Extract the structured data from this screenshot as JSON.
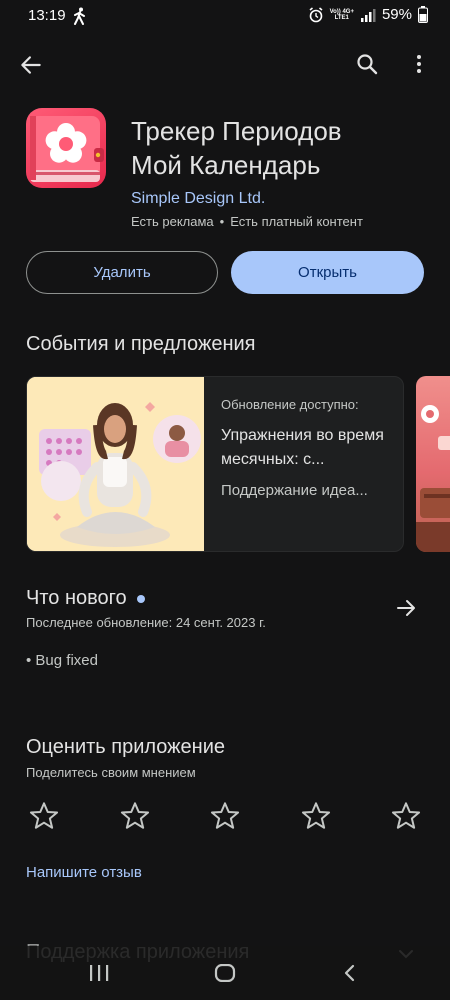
{
  "status": {
    "time": "13:19",
    "network_top": "Vo)) 4G+",
    "network_bottom": "LTE1",
    "battery": "59%"
  },
  "app_bar": {
    "icons": [
      "back-arrow-icon",
      "search-icon",
      "more-vert-icon"
    ]
  },
  "app": {
    "title_line1": "Трекер Периодов",
    "title_line2": "Мой Календарь",
    "developer": "Simple Design Ltd.",
    "ads": "Есть реклама",
    "separator": "•",
    "iap": "Есть платный контент"
  },
  "actions": {
    "uninstall": "Удалить",
    "open": "Открыть"
  },
  "events": {
    "title": "События и предложения",
    "card": {
      "label": "Обновление доступно:",
      "headline": "Упражнения во время месячных: с...",
      "description": "Поддержание идеа..."
    }
  },
  "whats_new": {
    "title": "Что нового",
    "updated": "Последнее обновление: 24 сент. 2023 г.",
    "changes": "• Bug fixed"
  },
  "rating": {
    "title": "Оценить приложение",
    "subtitle": "Поделитесь своим мнением",
    "stars": 5,
    "write_review": "Напишите отзыв"
  },
  "support": {
    "title": "Поддержка приложения"
  },
  "colors": {
    "background": "#131314",
    "accent": "#a8c7fa",
    "accent_text": "#062e6f",
    "icon_bg": "#e8294d"
  }
}
